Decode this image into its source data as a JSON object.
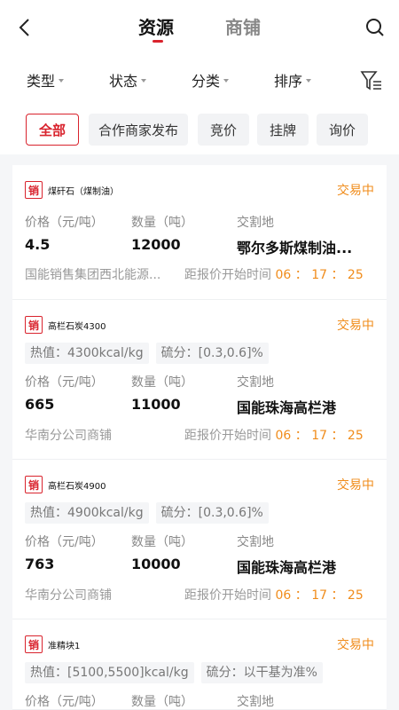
{
  "header": {
    "tabs": [
      {
        "label": "资源"
      },
      {
        "label": "商铺"
      }
    ]
  },
  "filters": {
    "items": [
      {
        "label": "类型"
      },
      {
        "label": "状态"
      },
      {
        "label": "分类"
      },
      {
        "label": "排序"
      }
    ]
  },
  "chips": [
    {
      "label": "全部"
    },
    {
      "label": "合作商家发布"
    },
    {
      "label": "竞价"
    },
    {
      "label": "挂牌"
    },
    {
      "label": "询价"
    }
  ],
  "labels": {
    "price": "价格（元/吨）",
    "quantity": "数量（吨）",
    "location": "交割地",
    "countdown": "距报价开始时间",
    "tag": "销"
  },
  "cards": [
    {
      "name": "煤矸石（煤制油）",
      "status": "交易中",
      "price": "4.5",
      "quantity": "12000",
      "location": "鄂尔多斯煤制油...",
      "vendor": "国能销售集团西北能源...",
      "h": "06",
      "m": "17",
      "s": "25"
    },
    {
      "name": "高栏石炭4300",
      "status": "交易中",
      "specs": [
        "热值：4300kcal/kg",
        "硫分：[0.3,0.6]%"
      ],
      "price": "665",
      "quantity": "11000",
      "location": "国能珠海高栏港",
      "vendor": "华南分公司商铺",
      "h": "06",
      "m": "17",
      "s": "25"
    },
    {
      "name": "高栏石炭4900",
      "status": "交易中",
      "specs": [
        "热值：4900kcal/kg",
        "硫分：[0.3,0.6]%"
      ],
      "price": "763",
      "quantity": "10000",
      "location": "国能珠海高栏港",
      "vendor": "华南分公司商铺",
      "h": "06",
      "m": "17",
      "s": "25"
    },
    {
      "name": "准精块1",
      "status": "交易中",
      "specs": [
        "热值：[5100,5500]kcal/kg",
        "硫分：以干基为准%"
      ]
    }
  ],
  "colors": {
    "accent": "#d9232d",
    "status": "#f08c1b"
  }
}
